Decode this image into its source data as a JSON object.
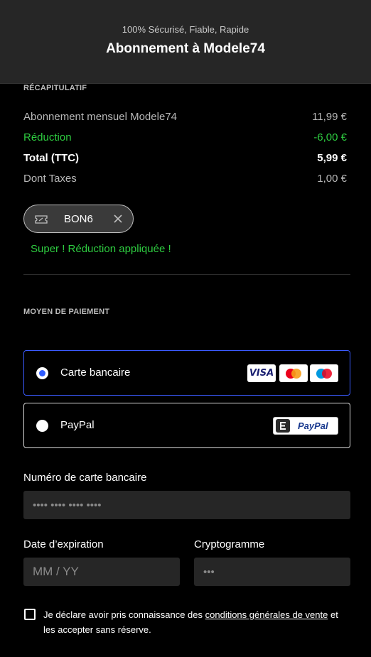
{
  "header": {
    "subtitle": "100% Sécurisé, Fiable, Rapide",
    "title": "Abonnement à Modele74"
  },
  "summary": {
    "section_label": "RÉCAPITULATIF",
    "lines": [
      {
        "label": "Abonnement mensuel Modele74",
        "value": "11,99 €"
      },
      {
        "label": "Réduction",
        "value": "-6,00 €"
      },
      {
        "label": "Total (TTC)",
        "value": "5,99 €"
      },
      {
        "label": "Dont Taxes",
        "value": "1,00 €"
      }
    ]
  },
  "coupon": {
    "code": "BON6",
    "success_message": "Super ! Réduction appliquée !"
  },
  "payment": {
    "section_label": "MOYEN DE PAIEMENT",
    "options": [
      {
        "label": "Carte bancaire",
        "selected": true
      },
      {
        "label": "PayPal",
        "selected": false
      }
    ],
    "card_logos": [
      "visa-logo",
      "mastercard-logo",
      "maestro-logo"
    ],
    "visa_text": "VISA",
    "paypal_text": "PayPal"
  },
  "form": {
    "card_number_label": "Numéro de carte bancaire",
    "card_number_placeholder": "•••• •••• •••• ••••",
    "expiry_label": "Date d’expiration",
    "expiry_placeholder": "MM / YY",
    "cvv_label": "Cryptogramme",
    "cvv_placeholder": "•••"
  },
  "terms": {
    "prefix": "Je déclare avoir pris connaissance des ",
    "link": "conditions générales de vente",
    "suffix": " et les accepter sans réserve."
  },
  "colors": {
    "accent": "#2f5cff",
    "success": "#2ecc40",
    "header_bg": "#262626",
    "input_bg": "#262626"
  }
}
